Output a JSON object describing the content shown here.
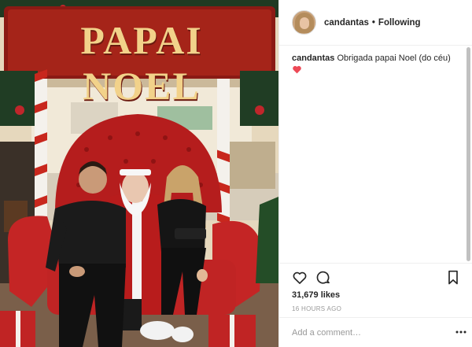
{
  "photo": {
    "sign_text": "PAPAI NOEL"
  },
  "header": {
    "username": "candantas",
    "separator": "•",
    "follow_status": "Following"
  },
  "caption": {
    "username": "candantas",
    "text": "Obrigada papai Noel (do céu)",
    "emoji": "heart"
  },
  "actions": {
    "like_icon": "heart-outline",
    "comment_icon": "speech-bubble",
    "save_icon": "bookmark"
  },
  "likes": "31,679 likes",
  "timestamp": "16 HOURS AGO",
  "comment": {
    "placeholder": "Add a comment…",
    "value": "",
    "more_icon": "ellipsis"
  },
  "colors": {
    "accent_red": "#ed4956",
    "text": "#262626",
    "muted": "#999999",
    "divider": "#efefef"
  }
}
